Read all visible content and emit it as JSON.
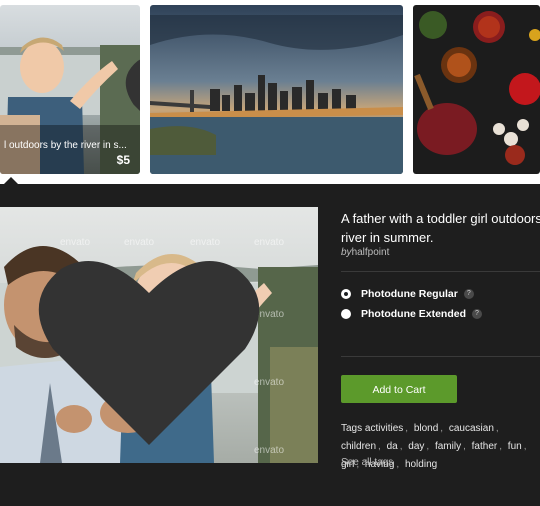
{
  "strip": {
    "thumb1_caption": "l outdoors by the river in s...",
    "thumb1_price": "$5"
  },
  "detail": {
    "title_line1": "A father with a toddler girl outdoors",
    "title_line2": "river in summer.",
    "author_prefix": "by",
    "author_name": "halfpoint",
    "licenses": [
      {
        "label": "Photodune Regular",
        "selected": true
      },
      {
        "label": "Photodune Extended",
        "selected": false
      }
    ],
    "help_glyph": "?",
    "cart_label": "Add to Cart",
    "tags_label": "Tags",
    "tags": [
      "activities",
      "blond",
      "caucasian",
      "children",
      "da",
      "day",
      "family",
      "father",
      "fun",
      "girl",
      "having",
      "holding"
    ],
    "see_all": "See all tags"
  },
  "watermark": "envato",
  "icons": {
    "heart": "heart-icon",
    "help": "help-icon"
  },
  "colors": {
    "background": "#1e1e1e",
    "cart_button": "#5c9a2b",
    "strip_background": "#ffffff"
  }
}
